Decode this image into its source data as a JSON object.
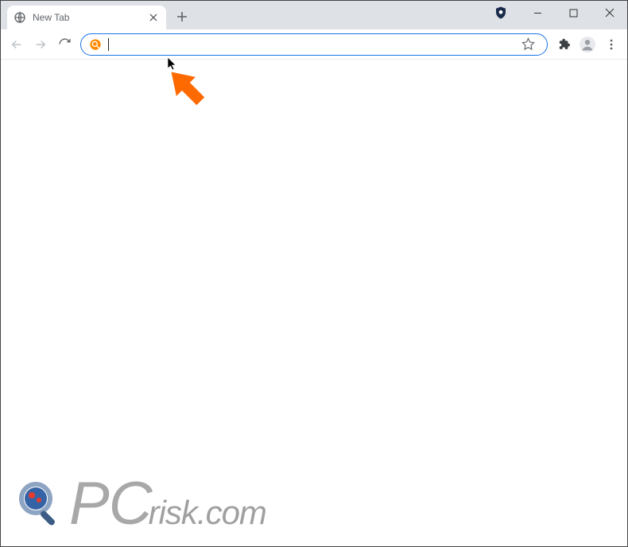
{
  "tab": {
    "title": "New Tab"
  },
  "omnibox": {
    "value": "",
    "placeholder": ""
  },
  "watermark": {
    "brand_pc": "PC",
    "brand_rest": "risk.com"
  },
  "colors": {
    "accent": "#1a73e8",
    "arrow": "#ff6a00",
    "search_icon": "#ff8a00",
    "watermark_gray": "#a0a0a0"
  }
}
